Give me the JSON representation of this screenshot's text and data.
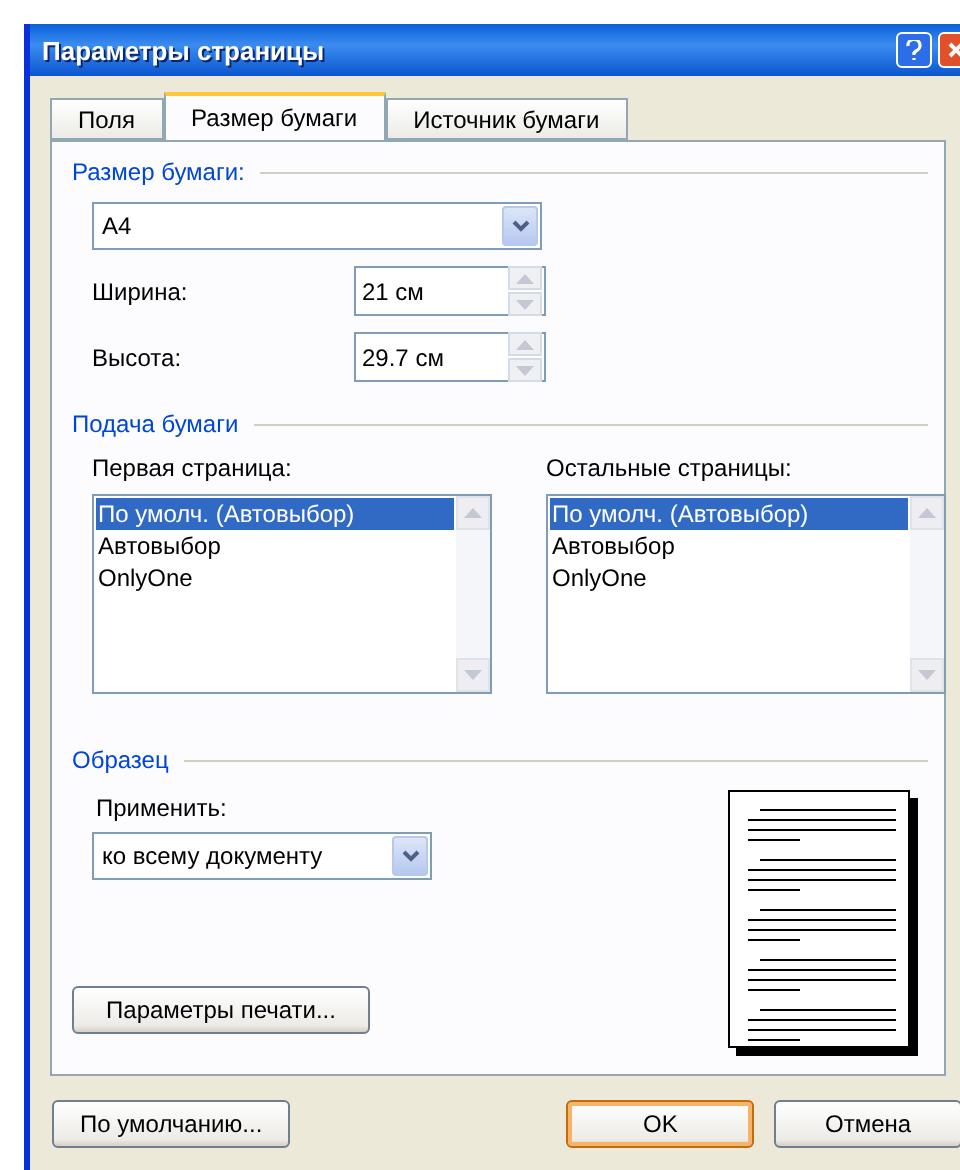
{
  "window": {
    "title": "Параметры страницы"
  },
  "tabs": [
    {
      "label": "Поля",
      "selected": false
    },
    {
      "label": "Размер бумаги",
      "selected": true
    },
    {
      "label": "Источник бумаги",
      "selected": false
    }
  ],
  "paper_size": {
    "heading": "Размер бумаги:",
    "value": "А4",
    "width_label": "Ширина:",
    "width": "21 см",
    "height_label": "Высота:",
    "height": "29.7 см"
  },
  "paper_source": {
    "heading": "Подача бумаги",
    "lists": [
      {
        "label": "Первая страница:",
        "items": [
          {
            "text": "По умолч. (Автовыбор)",
            "selected": true
          },
          {
            "text": "Автовыбор",
            "selected": false
          },
          {
            "text": "OnlyOne",
            "selected": false
          }
        ]
      },
      {
        "label": "Остальные страницы:",
        "items": [
          {
            "text": "По умолч. (Автовыбор)",
            "selected": true
          },
          {
            "text": "Автовыбор",
            "selected": false
          },
          {
            "text": "OnlyOne",
            "selected": false
          }
        ]
      }
    ]
  },
  "preview": {
    "heading": "Образец",
    "apply_label": "Применить:",
    "apply_value": "ко всему документу"
  },
  "print_options_button": "Параметры печати...",
  "buttons": [
    {
      "label": "По умолчанию...",
      "kind": "secondary"
    },
    {
      "label": "OK",
      "kind": "primary"
    },
    {
      "label": "Отмена",
      "kind": "secondary"
    }
  ]
}
